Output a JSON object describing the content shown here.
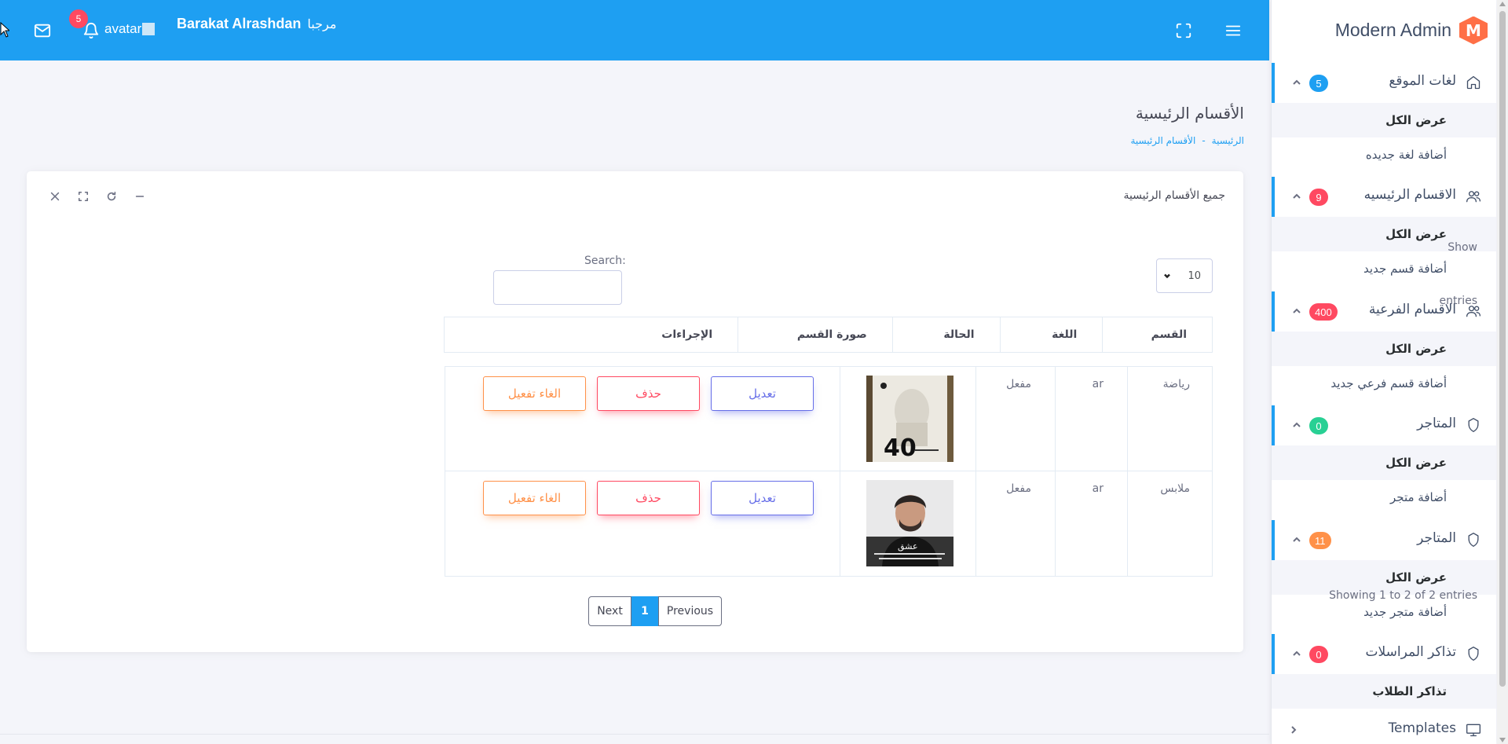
{
  "navbar": {
    "notifications_count": "5",
    "avatar_alt": "avatar",
    "user_name": "Barakat Alrashdan",
    "greeting": "مرجبا"
  },
  "sidebar": {
    "brand": "Modern Admin",
    "brand_logo": "M",
    "groups": [
      {
        "label": "لغات الموقع",
        "icon": "home-icon",
        "badge": "5",
        "badge_color": "#1e9ff2",
        "items": [
          {
            "label": "عرض الكل"
          },
          {
            "label": "أضافة لغة جديده"
          }
        ]
      },
      {
        "label": "الاقسام الرئيسيه",
        "icon": "users-icon",
        "badge": "9",
        "badge_color": "#ff4961",
        "items": [
          {
            "label": "عرض الكل"
          },
          {
            "label": "أضافة قسم جديد"
          }
        ]
      },
      {
        "label": "الاقسام الفرعية",
        "icon": "users-icon",
        "badge": "400",
        "badge_color": "#ff4961",
        "items": [
          {
            "label": "عرض الكل"
          },
          {
            "label": "أضافة قسم فرعي جديد"
          }
        ]
      },
      {
        "label": "المتاجر",
        "icon": "shield-icon",
        "badge": "0",
        "badge_color": "#28d094",
        "items": [
          {
            "label": "عرض الكل"
          },
          {
            "label": "أضافة متجر"
          }
        ]
      },
      {
        "label": "المتاجر",
        "icon": "shield-icon",
        "badge": "11",
        "badge_color": "#ff9149",
        "items": [
          {
            "label": "عرض الكل"
          },
          {
            "label": "أضافة متجر جديد"
          }
        ]
      },
      {
        "label": "تذاكر المراسلات",
        "icon": "shield-icon",
        "badge": "0",
        "badge_color": "#ff4961",
        "items": [
          {
            "label": "تذاكر الطلاب"
          }
        ]
      }
    ],
    "templates_label": "Templates"
  },
  "page": {
    "title": "الأقسام الرئيسية",
    "breadcrumb": [
      "الرئيسية",
      "الأقسام الرئيسية"
    ],
    "breadcrumb_sep": "-"
  },
  "card": {
    "title": "جميع الأقسام الرئيسية"
  },
  "table": {
    "show_label": "Show",
    "page_length": "10",
    "entries_label": "entries",
    "search_label": "Search:",
    "search_value": "",
    "columns": [
      "القسم",
      "اللغة",
      "الحالة",
      "صورة القسم",
      "الإجراءات"
    ],
    "rows": [
      {
        "name": "رياضة",
        "lang": "ar",
        "status": "مفعل",
        "image": "book-cover-image",
        "actions": {
          "edit": "تعديل",
          "delete": "حذف",
          "deactivate": "الغاء تفعيل"
        }
      },
      {
        "name": "ملابس",
        "lang": "ar",
        "status": "مفعل",
        "image": "portrait-poster-image",
        "actions": {
          "edit": "تعديل",
          "delete": "حذف",
          "deactivate": "الغاء تفعيل"
        }
      }
    ],
    "info": "Showing 1 to 2 of 2 entries",
    "pagination": {
      "next": "Next",
      "current": "1",
      "previous": "Previous"
    }
  },
  "colors": {
    "primary": "#1e9ff2",
    "danger": "#ff4961",
    "warning": "#ff9149",
    "info": "#666ee8",
    "success": "#28d094"
  }
}
